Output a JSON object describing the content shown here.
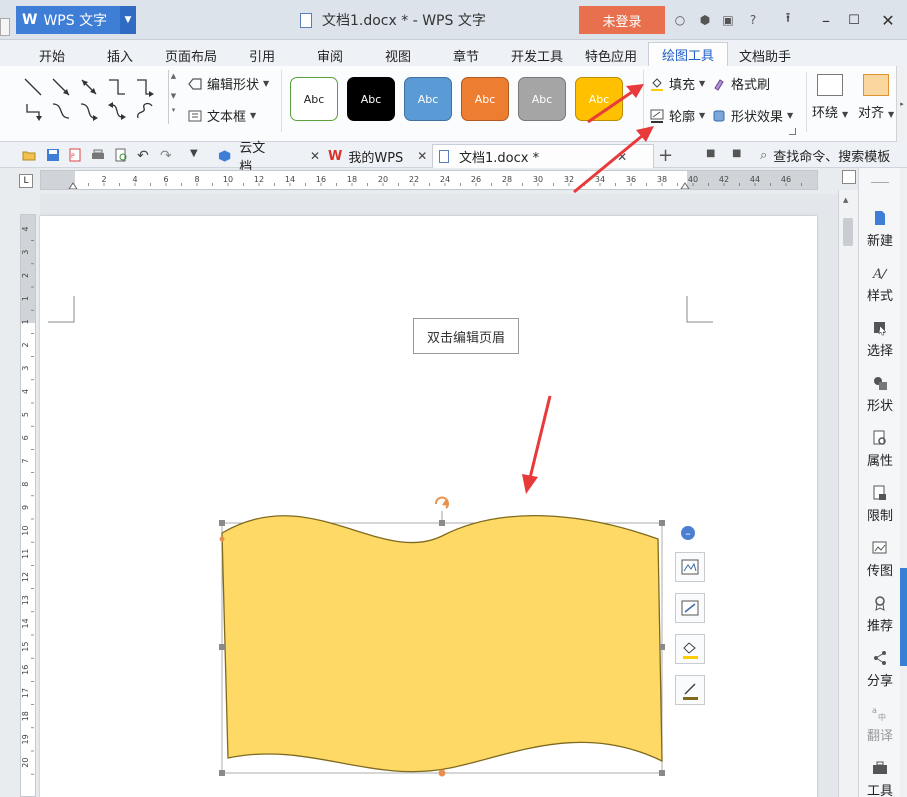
{
  "titlebar": {
    "app_name": "WPS 文字",
    "window_title": "文档1.docx * - WPS 文字",
    "login": "未登录"
  },
  "menu_tabs": [
    "开始",
    "插入",
    "页面布局",
    "引用",
    "审阅",
    "视图",
    "章节",
    "开发工具",
    "特色应用",
    "绘图工具",
    "文档助手"
  ],
  "active_tab": "绘图工具",
  "ribbon": {
    "edit_shape": "编辑形状",
    "text_box": "文本框",
    "style_label": "Abc",
    "fill": "填充",
    "format_painter": "格式刷",
    "outline": "轮廓",
    "shape_effects": "形状效果",
    "wrap": "环绕",
    "align": "对齐"
  },
  "style_swatches": [
    {
      "bg": "#ffffff",
      "border": "#5aa03c",
      "fg": "#222222"
    },
    {
      "bg": "#000000",
      "border": "#000000",
      "fg": "#ffffff"
    },
    {
      "bg": "#5b9bd5",
      "border": "#41719c",
      "fg": "#ffffff"
    },
    {
      "bg": "#ed7d31",
      "border": "#ae5a21",
      "fg": "#ffffff"
    },
    {
      "bg": "#a5a5a5",
      "border": "#787878",
      "fg": "#ffffff"
    },
    {
      "bg": "#ffc000",
      "border": "#bc8c00",
      "fg": "#ffffff"
    }
  ],
  "doc_tabs": {
    "cloud": "云文档",
    "my_wps": "我的WPS",
    "doc1": "文档1.docx *"
  },
  "search_command": "查找命令、搜索模板",
  "hruler_labels": [
    "2",
    "4",
    "6",
    "8",
    "10",
    "12",
    "14",
    "16",
    "18",
    "20",
    "22",
    "24",
    "26",
    "28",
    "30",
    "32",
    "34",
    "36",
    "38",
    "40",
    "42",
    "44",
    "46"
  ],
  "vruler_labels": [
    "4",
    "3",
    "2",
    "1",
    "1",
    "2",
    "3",
    "4",
    "5",
    "6",
    "7",
    "8",
    "9",
    "10",
    "11",
    "12",
    "13",
    "14",
    "15",
    "16",
    "17",
    "18",
    "19",
    "20"
  ],
  "header_hint": "双击编辑页眉",
  "sidebar": [
    "新建",
    "样式",
    "选择",
    "形状",
    "属性",
    "限制",
    "传图",
    "推荐",
    "分享",
    "翻译",
    "工具"
  ],
  "colors": {
    "accent_blue": "#3f7ed6",
    "login_orange": "#e8704e",
    "shape_fill": "#ffd966",
    "shape_outline": "#7f6a1e",
    "annotation_red": "#e83a3a"
  }
}
